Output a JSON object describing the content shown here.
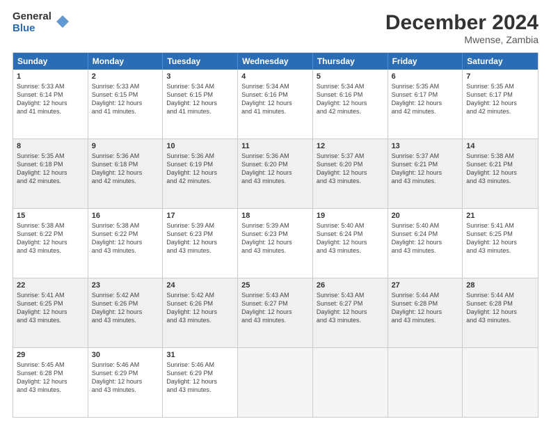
{
  "logo": {
    "general": "General",
    "blue": "Blue"
  },
  "title": "December 2024",
  "subtitle": "Mwense, Zambia",
  "days": [
    "Sunday",
    "Monday",
    "Tuesday",
    "Wednesday",
    "Thursday",
    "Friday",
    "Saturday"
  ],
  "weeks": [
    [
      {
        "day": "1",
        "sunrise": "5:33 AM",
        "sunset": "6:14 PM",
        "daylight": "12 hours and 41 minutes."
      },
      {
        "day": "2",
        "sunrise": "5:33 AM",
        "sunset": "6:15 PM",
        "daylight": "12 hours and 41 minutes."
      },
      {
        "day": "3",
        "sunrise": "5:34 AM",
        "sunset": "6:15 PM",
        "daylight": "12 hours and 41 minutes."
      },
      {
        "day": "4",
        "sunrise": "5:34 AM",
        "sunset": "6:16 PM",
        "daylight": "12 hours and 41 minutes."
      },
      {
        "day": "5",
        "sunrise": "5:34 AM",
        "sunset": "6:16 PM",
        "daylight": "12 hours and 42 minutes."
      },
      {
        "day": "6",
        "sunrise": "5:35 AM",
        "sunset": "6:17 PM",
        "daylight": "12 hours and 42 minutes."
      },
      {
        "day": "7",
        "sunrise": "5:35 AM",
        "sunset": "6:17 PM",
        "daylight": "12 hours and 42 minutes."
      }
    ],
    [
      {
        "day": "8",
        "sunrise": "5:35 AM",
        "sunset": "6:18 PM",
        "daylight": "12 hours and 42 minutes."
      },
      {
        "day": "9",
        "sunrise": "5:36 AM",
        "sunset": "6:18 PM",
        "daylight": "12 hours and 42 minutes."
      },
      {
        "day": "10",
        "sunrise": "5:36 AM",
        "sunset": "6:19 PM",
        "daylight": "12 hours and 42 minutes."
      },
      {
        "day": "11",
        "sunrise": "5:36 AM",
        "sunset": "6:20 PM",
        "daylight": "12 hours and 43 minutes."
      },
      {
        "day": "12",
        "sunrise": "5:37 AM",
        "sunset": "6:20 PM",
        "daylight": "12 hours and 43 minutes."
      },
      {
        "day": "13",
        "sunrise": "5:37 AM",
        "sunset": "6:21 PM",
        "daylight": "12 hours and 43 minutes."
      },
      {
        "day": "14",
        "sunrise": "5:38 AM",
        "sunset": "6:21 PM",
        "daylight": "12 hours and 43 minutes."
      }
    ],
    [
      {
        "day": "15",
        "sunrise": "5:38 AM",
        "sunset": "6:22 PM",
        "daylight": "12 hours and 43 minutes."
      },
      {
        "day": "16",
        "sunrise": "5:38 AM",
        "sunset": "6:22 PM",
        "daylight": "12 hours and 43 minutes."
      },
      {
        "day": "17",
        "sunrise": "5:39 AM",
        "sunset": "6:23 PM",
        "daylight": "12 hours and 43 minutes."
      },
      {
        "day": "18",
        "sunrise": "5:39 AM",
        "sunset": "6:23 PM",
        "daylight": "12 hours and 43 minutes."
      },
      {
        "day": "19",
        "sunrise": "5:40 AM",
        "sunset": "6:24 PM",
        "daylight": "12 hours and 43 minutes."
      },
      {
        "day": "20",
        "sunrise": "5:40 AM",
        "sunset": "6:24 PM",
        "daylight": "12 hours and 43 minutes."
      },
      {
        "day": "21",
        "sunrise": "5:41 AM",
        "sunset": "6:25 PM",
        "daylight": "12 hours and 43 minutes."
      }
    ],
    [
      {
        "day": "22",
        "sunrise": "5:41 AM",
        "sunset": "6:25 PM",
        "daylight": "12 hours and 43 minutes."
      },
      {
        "day": "23",
        "sunrise": "5:42 AM",
        "sunset": "6:26 PM",
        "daylight": "12 hours and 43 minutes."
      },
      {
        "day": "24",
        "sunrise": "5:42 AM",
        "sunset": "6:26 PM",
        "daylight": "12 hours and 43 minutes."
      },
      {
        "day": "25",
        "sunrise": "5:43 AM",
        "sunset": "6:27 PM",
        "daylight": "12 hours and 43 minutes."
      },
      {
        "day": "26",
        "sunrise": "5:43 AM",
        "sunset": "6:27 PM",
        "daylight": "12 hours and 43 minutes."
      },
      {
        "day": "27",
        "sunrise": "5:44 AM",
        "sunset": "6:28 PM",
        "daylight": "12 hours and 43 minutes."
      },
      {
        "day": "28",
        "sunrise": "5:44 AM",
        "sunset": "6:28 PM",
        "daylight": "12 hours and 43 minutes."
      }
    ],
    [
      {
        "day": "29",
        "sunrise": "5:45 AM",
        "sunset": "6:28 PM",
        "daylight": "12 hours and 43 minutes."
      },
      {
        "day": "30",
        "sunrise": "5:46 AM",
        "sunset": "6:29 PM",
        "daylight": "12 hours and 43 minutes."
      },
      {
        "day": "31",
        "sunrise": "5:46 AM",
        "sunset": "6:29 PM",
        "daylight": "12 hours and 43 minutes."
      },
      null,
      null,
      null,
      null
    ]
  ],
  "labels": {
    "sunrise": "Sunrise:",
    "sunset": "Sunset:",
    "daylight": "Daylight:"
  }
}
